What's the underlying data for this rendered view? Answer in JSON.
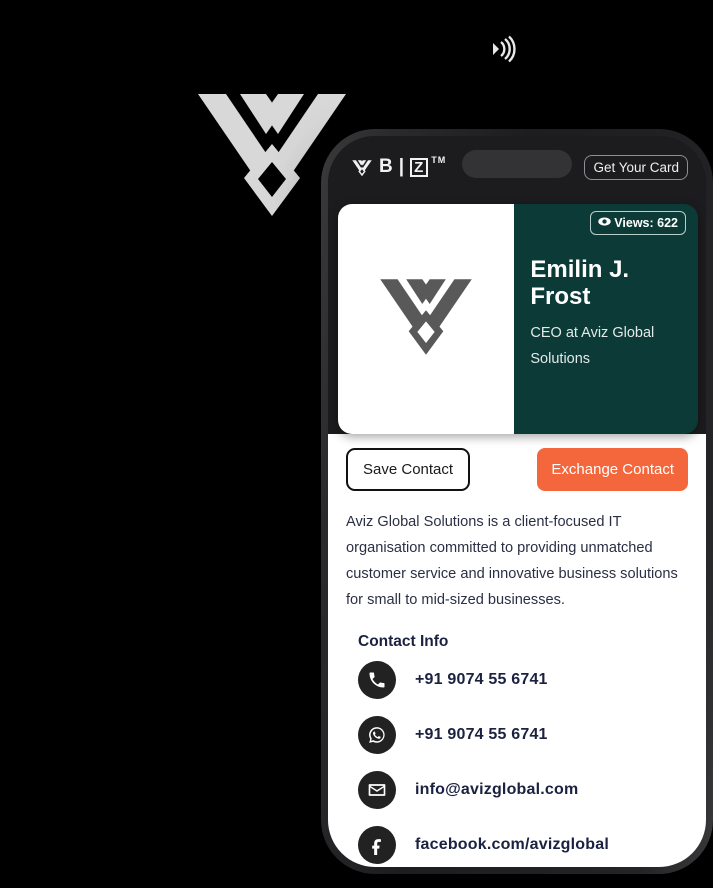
{
  "background": {
    "logo_icon": "aviz-w-logo",
    "nfc_icon": "broadcast-waves-icon",
    "panel_color": "#000000"
  },
  "phone": {
    "appbar": {
      "brand_logo_icon": "aviz-w-logo-small",
      "brand_text_b": "B",
      "brand_divider": "|",
      "brand_text_z": "Z",
      "brand_tm": "TM",
      "dynamic_island": "dynamic-island",
      "get_card_label": "Get Your Card"
    },
    "card": {
      "logo_icon": "aviz-w-logo-card",
      "views_icon": "eye-icon",
      "views_label": "Views: 622",
      "name": "Emilin J. Frost",
      "title": "CEO at Aviz Global Solutions",
      "accent_color": "#0b3a37"
    },
    "actions": {
      "save_label": "Save Contact",
      "exchange_label": "Exchange Contact",
      "exchange_color": "#f4663c"
    },
    "about": "Aviz Global Solutions is a client-focused IT organisation committed to providing unmatched customer service and innovative business solutions for small to mid-sized businesses.",
    "contact": {
      "heading": "Contact Info",
      "items": [
        {
          "icon": "phone-icon",
          "value": "+91 9074 55 6741"
        },
        {
          "icon": "whatsapp-icon",
          "value": "+91 9074 55 6741"
        },
        {
          "icon": "email-icon",
          "value": "info@avizglobal.com"
        },
        {
          "icon": "facebook-icon",
          "value": "facebook.com/avizglobal"
        }
      ]
    }
  }
}
